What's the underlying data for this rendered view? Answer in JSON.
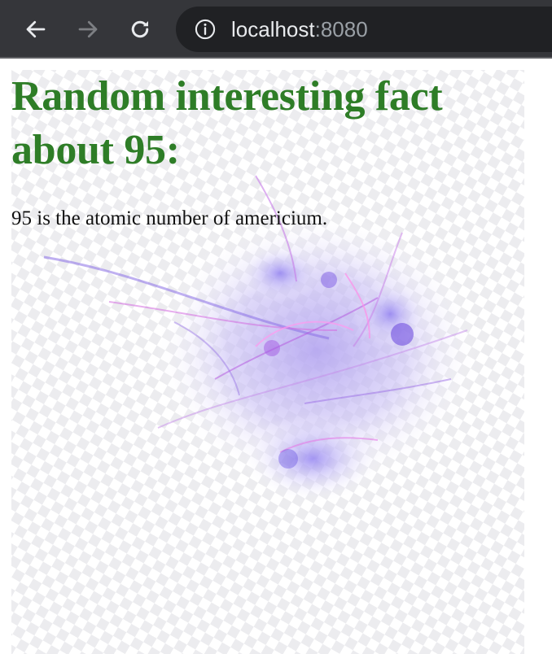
{
  "browser": {
    "url_host": "localhost",
    "url_port": ":8080",
    "icons": {
      "back": "arrow-left-icon",
      "forward": "arrow-right-icon",
      "reload": "reload-icon",
      "site_info": "info-icon"
    },
    "colors": {
      "toolbar": "#35363a",
      "omnibox": "#202124",
      "url_host": "#e8eaed",
      "url_port": "#9aa0a6"
    }
  },
  "page": {
    "heading": "Random interesting fact about 95:",
    "fact": "95 is the atomic number of americium.",
    "colors": {
      "heading": "#2e7d27",
      "text": "#111111"
    }
  }
}
